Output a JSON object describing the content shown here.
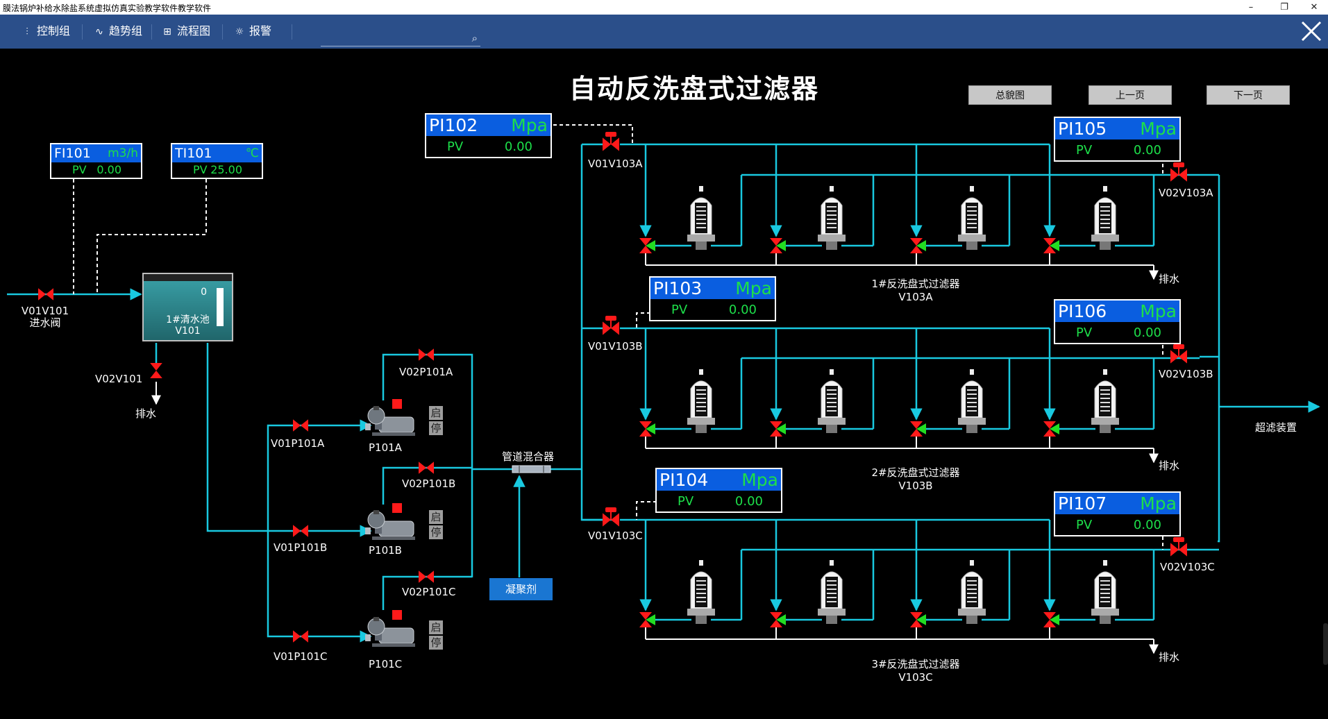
{
  "window": {
    "title": "膜法锅炉补给水除盐系统虚拟仿真实验教学软件教学软件",
    "minimize": "–",
    "restore": "❐",
    "close": "✕"
  },
  "menu": {
    "items": [
      {
        "label": "控制组",
        "icon": "sliders-icon"
      },
      {
        "label": "趋势组",
        "icon": "trend-icon"
      },
      {
        "label": "流程图",
        "icon": "flowchart-icon"
      },
      {
        "label": "报警",
        "icon": "alarm-icon"
      }
    ],
    "search_placeholder": ""
  },
  "page": {
    "title": "自动反洗盘式过滤器"
  },
  "nav": {
    "overview": "总貌图",
    "prev": "上一页",
    "next": "下一页"
  },
  "instruments": {
    "FI101": {
      "name": "FI101",
      "unit": "m3/h",
      "pv_label": "PV",
      "value": "0.00"
    },
    "TI101": {
      "name": "TI101",
      "unit": "℃",
      "pv_label": "PV",
      "value": "25.00"
    },
    "PI102": {
      "name": "PI102",
      "unit": "Mpa",
      "pv_label": "PV",
      "value": "0.00"
    },
    "PI103": {
      "name": "PI103",
      "unit": "Mpa",
      "pv_label": "PV",
      "value": "0.00"
    },
    "PI104": {
      "name": "PI104",
      "unit": "Mpa",
      "pv_label": "PV",
      "value": "0.00"
    },
    "PI105": {
      "name": "PI105",
      "unit": "Mpa",
      "pv_label": "PV",
      "value": "0.00"
    },
    "PI106": {
      "name": "PI106",
      "unit": "Mpa",
      "pv_label": "PV",
      "value": "0.00"
    },
    "PI107": {
      "name": "PI107",
      "unit": "Mpa",
      "pv_label": "PV",
      "value": "0.00"
    }
  },
  "tank": {
    "value": "0",
    "name_line1": "1#清水池",
    "name_line2": "V101"
  },
  "labels": {
    "v01v101": "V01V101",
    "v01v101_desc": "进水阀",
    "v02v101": "V02V101",
    "drain": "排水",
    "v01p101a": "V01P101A",
    "v01p101b": "V01P101B",
    "v01p101c": "V01P101C",
    "v02p101a": "V02P101A",
    "v02p101b": "V02P101B",
    "v02p101c": "V02P101C",
    "p101a": "P101A",
    "p101b": "P101B",
    "p101c": "P101C",
    "start": "启",
    "stop": "停",
    "mixer": "管道混合器",
    "coagulant": "凝聚剂",
    "v01v103a": "V01V103A",
    "v01v103b": "V01V103B",
    "v01v103c": "V01V103C",
    "v02v103a": "V02V103A",
    "v02v103b": "V02V103B",
    "v02v103c": "V02V103C",
    "filter_a1": "1#反洗盘式过滤器",
    "filter_a2": "V103A",
    "filter_b1": "2#反洗盘式过滤器",
    "filter_b2": "V103B",
    "filter_c1": "3#反洗盘式过滤器",
    "filter_c2": "V103C",
    "drain_a": "排水",
    "drain_b": "排水",
    "drain_c": "排水",
    "uf": "超滤装置"
  },
  "colors": {
    "pipe": "#19c9e0",
    "valve_closed": "#ff1a1a",
    "valve_open": "#22dd22",
    "tag_header": "#0a5ee0",
    "pv_text": "#1ddf4a",
    "menubar": "#2b4f8a"
  }
}
